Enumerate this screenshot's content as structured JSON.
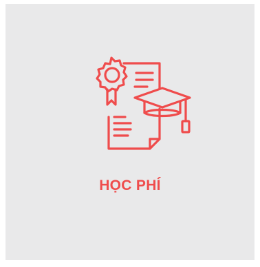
{
  "tile": {
    "label": "HỌC PHÍ",
    "icon": "certificate-graduation-cap-icon"
  },
  "colors": {
    "tile_background": "#e9e9ea",
    "accent": "#ef4c4c"
  }
}
